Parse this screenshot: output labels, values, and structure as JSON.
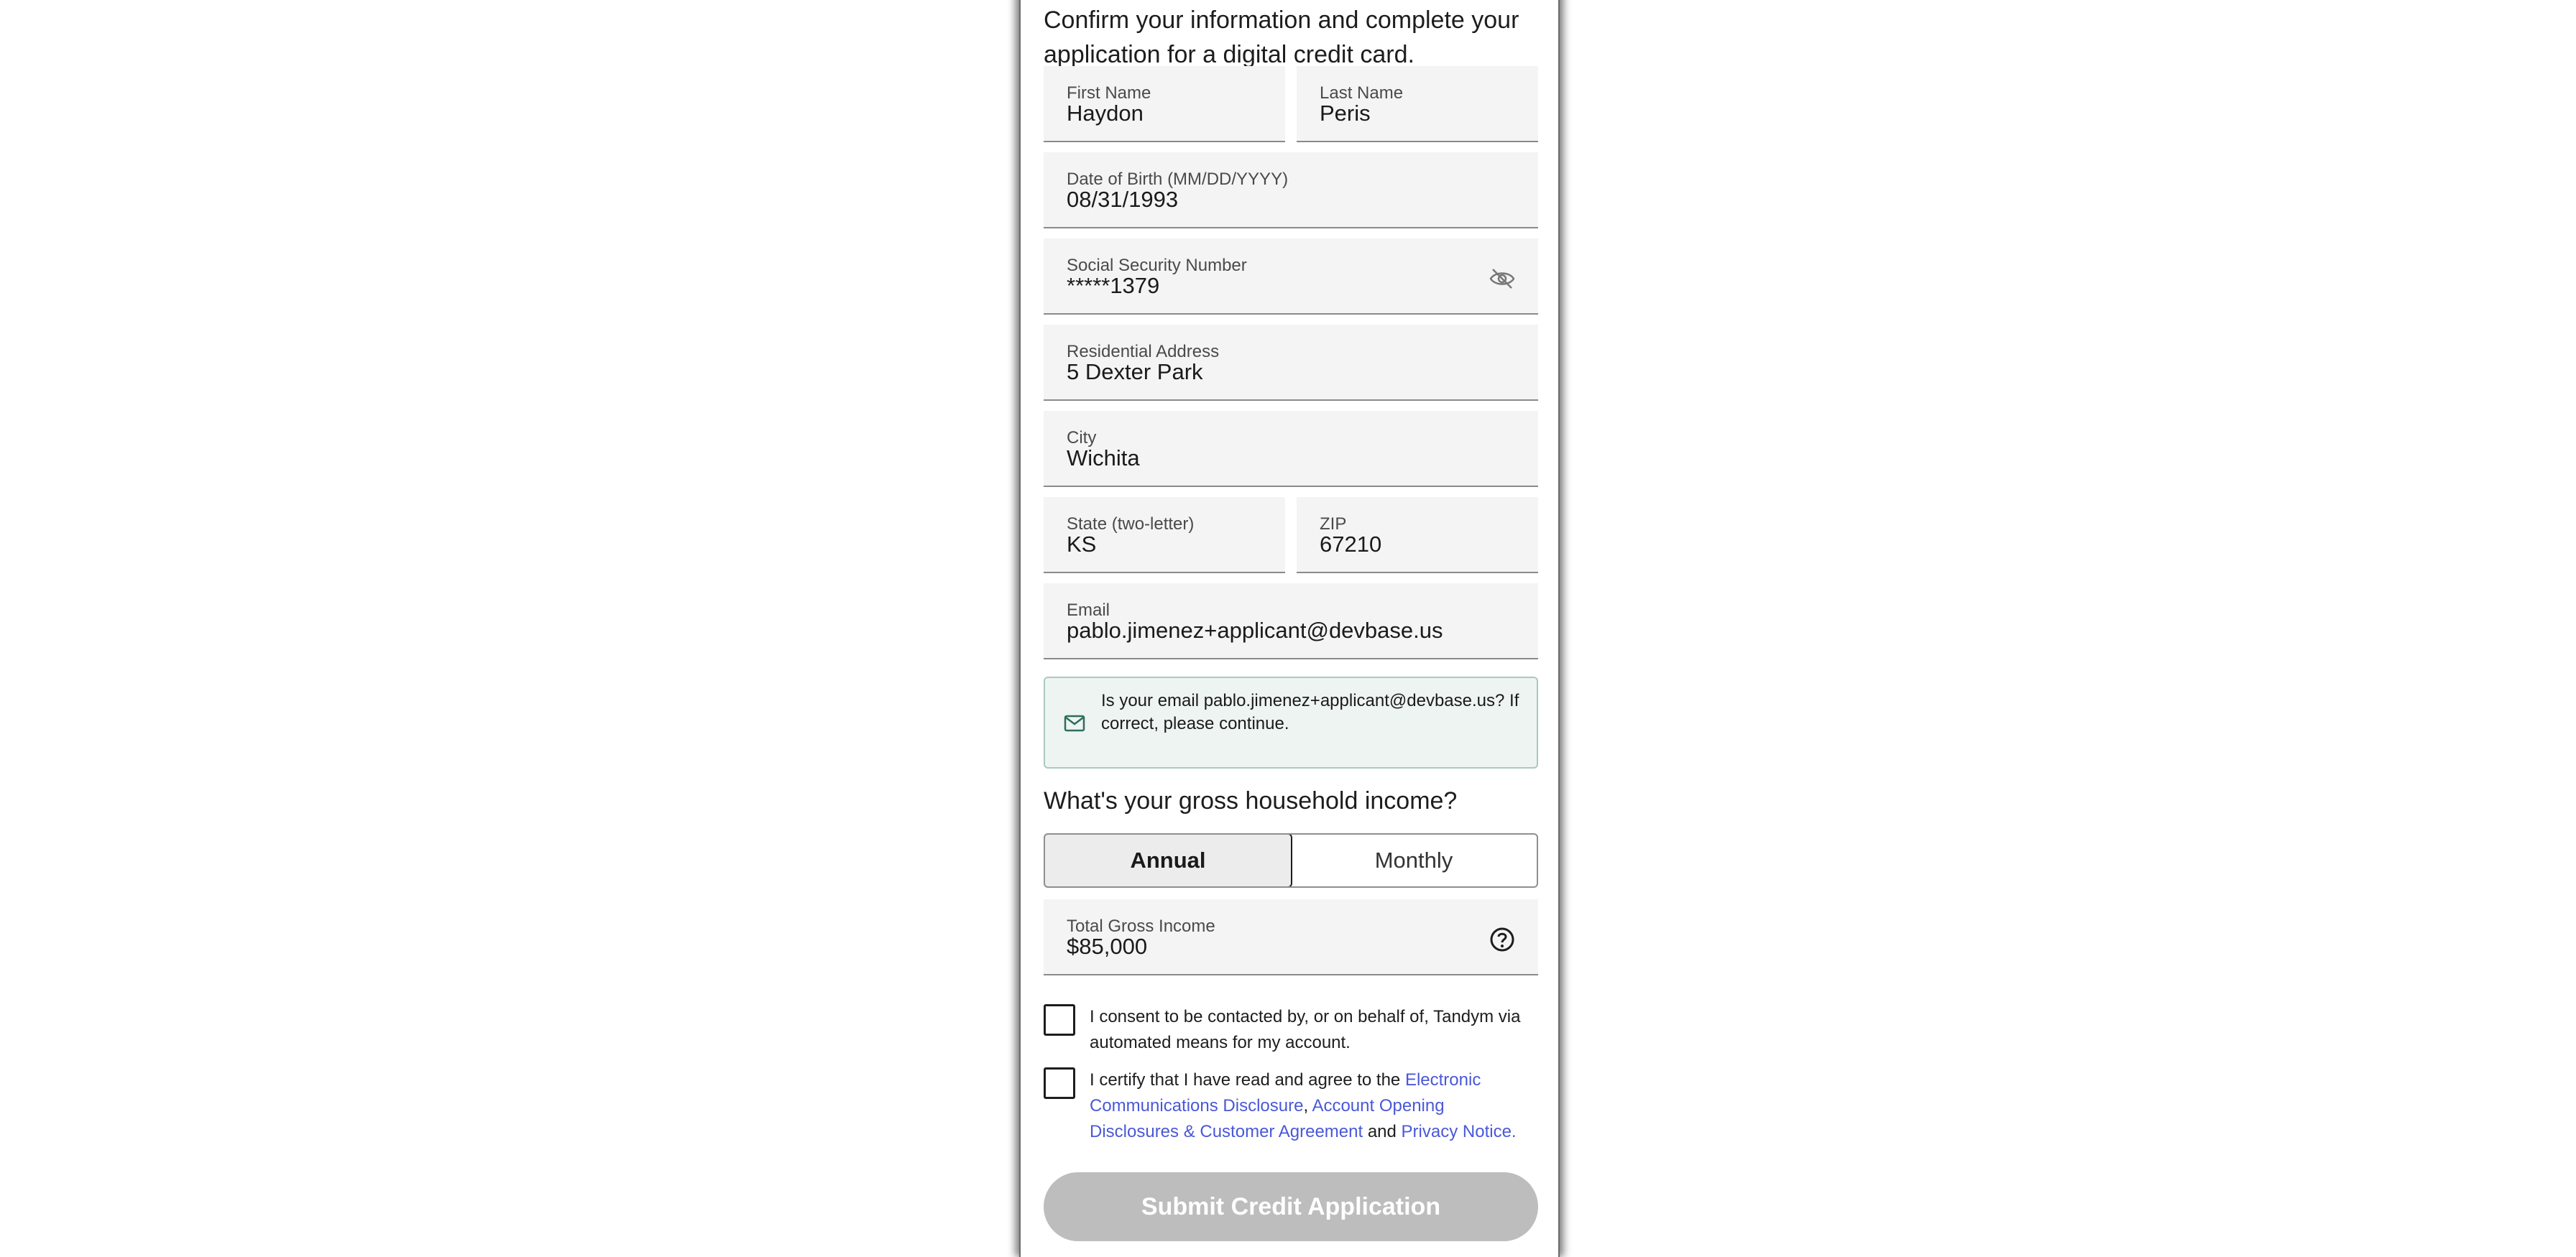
{
  "intro": "Confirm your information and complete your application for a digital credit card.",
  "fields": {
    "first_name": {
      "label": "First Name",
      "value": "Haydon"
    },
    "last_name": {
      "label": "Last Name",
      "value": "Peris"
    },
    "dob": {
      "label": "Date of Birth (MM/DD/YYYY)",
      "value": "08/31/1993"
    },
    "ssn": {
      "label": "Social Security Number",
      "value": "*****1379",
      "icon": "eye-off-icon"
    },
    "address": {
      "label": "Residential Address",
      "value": "5 Dexter Park"
    },
    "city": {
      "label": "City",
      "value": "Wichita"
    },
    "state": {
      "label": "State (two-letter)",
      "value": "KS"
    },
    "zip": {
      "label": "ZIP",
      "value": "67210"
    },
    "email": {
      "label": "Email",
      "value": "pablo.jimenez+applicant@devbase.us"
    },
    "income": {
      "label": "Total Gross Income",
      "value": "$85,000",
      "icon": "help-circle-icon"
    }
  },
  "email_notice": {
    "text": "Is your email pablo.jimenez+applicant@devbase.us? If correct, please continue.",
    "icon": "mail-icon"
  },
  "income_question": "What's your gross household income?",
  "income_toggle": {
    "annual": "Annual",
    "monthly": "Monthly",
    "selected": "Annual"
  },
  "consent": {
    "contact_text": "I consent to be contacted by, or on behalf of, Tandym via automated means for my account.",
    "certify_prefix": "I certify that I have read and agree to the ",
    "link_ecd": "Electronic Communications Disclosure",
    "sep_comma": ", ",
    "link_account": "Account Opening Disclosures & Customer Agreement",
    "sep_and": " and ",
    "link_privacy": "Privacy Notice."
  },
  "submit_label": "Submit Credit Application",
  "colors": {
    "link": "#4a58d8",
    "notice_bg": "#eef4f2",
    "button_disabled": "#bdbdbd"
  }
}
